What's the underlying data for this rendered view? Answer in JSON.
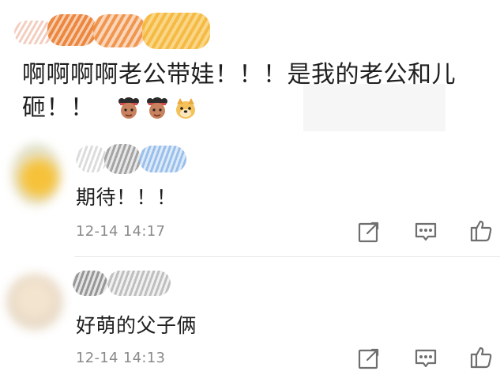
{
  "comments": [
    {
      "text_line1": "啊啊啊啊老公带娃！！！是我的老公和儿",
      "text_line2": "砸！！",
      "emojis": [
        "girl-face-icon",
        "girl-face-icon",
        "doge-icon"
      ]
    }
  ],
  "replies": [
    {
      "text": "期待！！！",
      "time": "12-14 14:17",
      "icons": [
        "share-icon",
        "comment-icon",
        "like-icon"
      ]
    },
    {
      "text": "好萌的父子俩",
      "time": "12-14 14:13",
      "icons": [
        "share-icon",
        "comment-icon",
        "like-icon"
      ]
    }
  ],
  "colors": {
    "text": "#1f1f1f",
    "meta": "#8a8a8a",
    "divider": "#e7e7e7",
    "icon": "#6f6f6f"
  }
}
